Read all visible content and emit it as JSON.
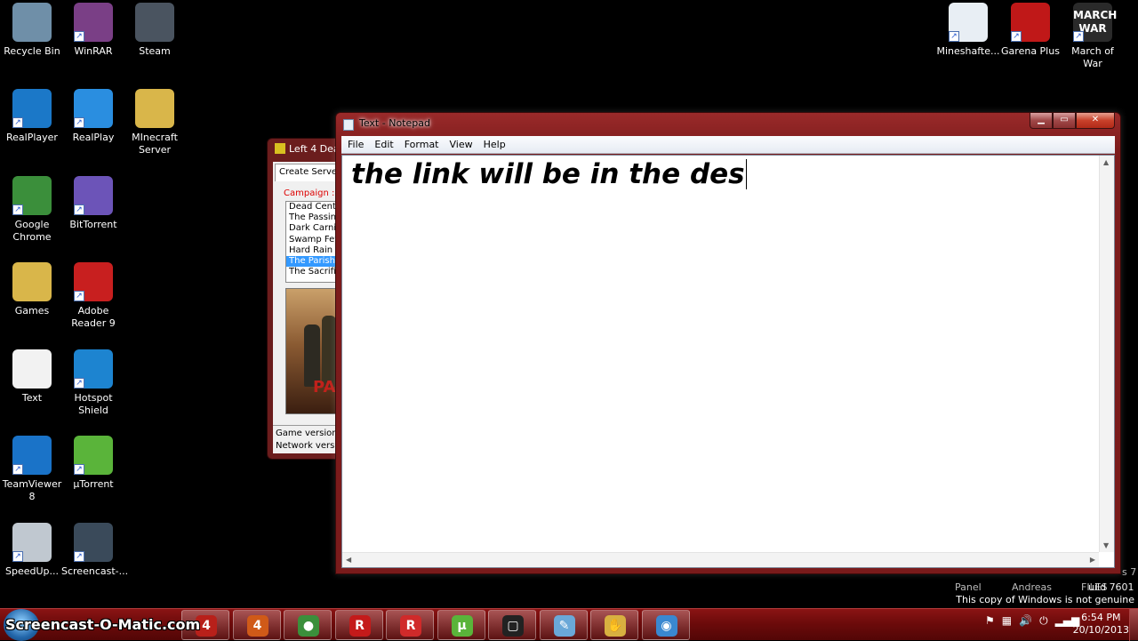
{
  "desktop_icons": [
    {
      "label": "Recycle Bin",
      "icon": "recycle-bin-icon",
      "color": "#6f8fa8",
      "shortcut": false
    },
    {
      "label": "WinRAR",
      "icon": "winrar-icon",
      "color": "#7a3f86",
      "shortcut": true
    },
    {
      "label": "Steam",
      "icon": "steam-icon",
      "color": "#4a5460",
      "shortcut": false
    },
    {
      "label": "RealPlayer",
      "icon": "realplayer-icon",
      "color": "#1b78c8",
      "shortcut": true
    },
    {
      "label": "RealPlay",
      "icon": "realplay-icon",
      "color": "#2a8ee0",
      "shortcut": true
    },
    {
      "label": "MInecraft Server",
      "icon": "folder-icon",
      "color": "#d9b64a",
      "shortcut": false
    },
    {
      "label": "Google Chrome",
      "icon": "chrome-icon",
      "color": "#3b8f3b",
      "shortcut": true
    },
    {
      "label": "BitTorrent",
      "icon": "bittorrent-icon",
      "color": "#6c54b8",
      "shortcut": true
    },
    {
      "label": "Games",
      "icon": "folder-icon",
      "color": "#d9b64a",
      "shortcut": false
    },
    {
      "label": "Adobe Reader 9",
      "icon": "adobe-reader-icon",
      "color": "#c81f1f",
      "shortcut": true
    },
    {
      "label": "Text",
      "icon": "text-file-icon",
      "color": "#f2f2f2",
      "shortcut": false
    },
    {
      "label": "Hotspot Shield",
      "icon": "hotspot-shield-icon",
      "color": "#1d84d0",
      "shortcut": true
    },
    {
      "label": "TeamViewer 8",
      "icon": "teamviewer-icon",
      "color": "#1a73c8",
      "shortcut": true
    },
    {
      "label": "µTorrent",
      "icon": "utorrent-icon",
      "color": "#5ab43a",
      "shortcut": true
    },
    {
      "label": "SpeedUp...",
      "icon": "speedometer-icon",
      "color": "#c0c8d0",
      "shortcut": true
    },
    {
      "label": "Screencast-...",
      "icon": "screencast-icon",
      "color": "#3a4a5a",
      "shortcut": true
    },
    {
      "label": "Mineshafte...",
      "icon": "java-file-icon",
      "color": "#e8eef4",
      "shortcut": true
    },
    {
      "label": "Garena Plus",
      "icon": "garena-icon",
      "color": "#c01818",
      "shortcut": true
    },
    {
      "label": "March of War",
      "icon": "march-of-war-icon",
      "color": "#2a2a2a",
      "shortcut": true
    }
  ],
  "march_logo_text": "MARCH WAR",
  "l4d_window": {
    "title": "Left 4 Dea",
    "tab": "Create Server",
    "campaign_label": "Campaign :",
    "campaigns": [
      "Dead Cente",
      "The Passing",
      "Dark Carniv",
      "Swamp Fev",
      "Hard Rain",
      "The Parish",
      "The Sacrific"
    ],
    "selected_index": 5,
    "poster_text": "PAR",
    "game_version_label": "Game version",
    "network_version_label": "Network versio"
  },
  "notepad": {
    "title": "Text - Notepad",
    "menu": [
      "File",
      "Edit",
      "Format",
      "View",
      "Help"
    ],
    "content": "the link will be in the des",
    "caption_buttons": {
      "minimize": "▁",
      "maximize": "▭",
      "close": "✕"
    }
  },
  "desktop_faint_labels": {
    "panel": "Panel",
    "andreas": "Andreas",
    "files": "FILES",
    "windows7": "s 7",
    "build": "uild 7601"
  },
  "genuine_notice": "This copy of Windows is not genuine",
  "taskbar": {
    "watermark": "Screencast-O-Matic.com",
    "buttons": [
      {
        "name": "l4d-a",
        "glyph": "4",
        "color": "#b8201a"
      },
      {
        "name": "l4d-b",
        "glyph": "4",
        "color": "#d05a18"
      },
      {
        "name": "chrome",
        "glyph": "●",
        "color": "#3b8f3b"
      },
      {
        "name": "roblox-a",
        "glyph": "R",
        "color": "#c41a1a"
      },
      {
        "name": "roblox-b",
        "glyph": "R",
        "color": "#d02a2a"
      },
      {
        "name": "utorrent",
        "glyph": "µ",
        "color": "#5ab43a"
      },
      {
        "name": "screencast-frame",
        "glyph": "▢",
        "color": "#222222"
      },
      {
        "name": "notepad",
        "glyph": "✎",
        "color": "#6aa8d8"
      },
      {
        "name": "l4d-hand",
        "glyph": "✋",
        "color": "#d8b040"
      },
      {
        "name": "film",
        "glyph": "◉",
        "color": "#3a88d0"
      }
    ],
    "clock_time": "6:54 PM",
    "clock_date": "20/10/2013"
  }
}
